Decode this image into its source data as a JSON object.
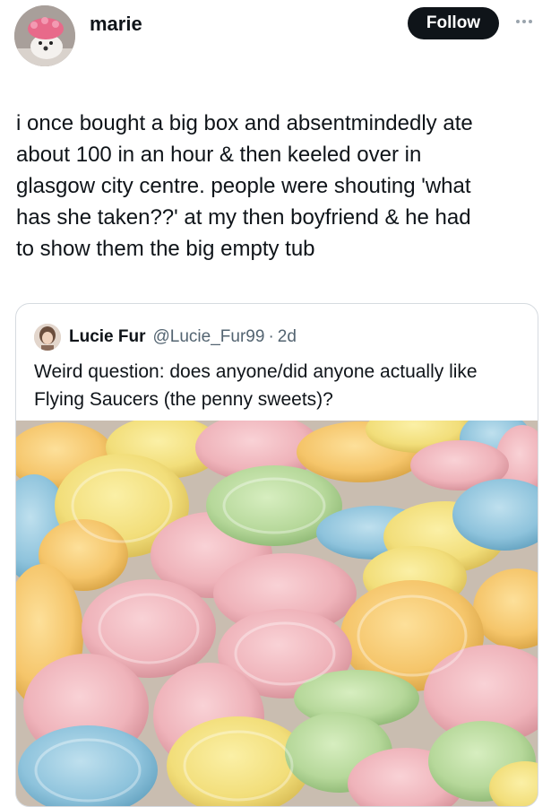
{
  "post": {
    "author": {
      "name": "marie",
      "avatar_icon": "pink-dog-avatar"
    },
    "follow_label": "Follow",
    "more_icon": "more-dots-icon",
    "text": "i once bought a big box and absentmindedly ate\nabout 100 in an hour & then keeled over in\nglasgow city centre. people were shouting 'what\nhas she taken??' at my then boyfriend & he had\nto show them the big empty tub"
  },
  "quoted": {
    "author_name": "Lucie Fur",
    "handle": "@Lucie_Fur99",
    "separator": "·",
    "time": "2d",
    "text": "Weird question: does anyone/did anyone actually like Flying Saucers (the penny sweets)?",
    "image_icon": "flying-saucer-sweets-photo"
  },
  "colors": {
    "follow_bg": "#0f1419",
    "muted_text": "#536471",
    "pastel_yellow": "#f2de7a",
    "pastel_pink": "#efb3ba",
    "pastel_green": "#b6d89a",
    "pastel_blue": "#8ec3dc",
    "pastel_orange": "#f5c56a"
  }
}
